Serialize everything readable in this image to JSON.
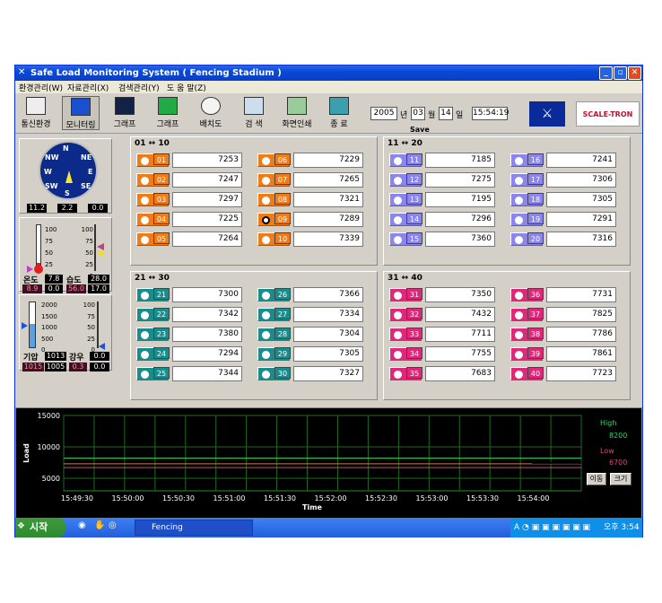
{
  "window": {
    "title": "Safe Load Monitoring System ( Fencing Stadium )"
  },
  "menu": [
    "환경관리(W)",
    "자료관리(X)",
    "검색관리(Y)",
    "도 움 말(Z)"
  ],
  "toolbar": [
    "통신환경",
    "모니터링",
    "그래프",
    "그래프",
    "배치도",
    "검 색",
    "화면인쇄",
    "종 료"
  ],
  "date": {
    "year": "2005",
    "year_unit": "년",
    "month": "03",
    "month_unit": "월",
    "day": "14",
    "day_unit": "일",
    "time": "15:54:19",
    "save": "Save"
  },
  "brand": "SCALE-TRON",
  "compass": {
    "n": "N",
    "ne": "NE",
    "e": "E",
    "se": "SE",
    "s": "S",
    "sw": "SW",
    "w": "W",
    "nw": "NW",
    "r1": "11.2",
    "r2": "2.2",
    "r3": "0.0"
  },
  "thermo": {
    "ticks": [
      "100",
      "75",
      "50",
      "25",
      "0"
    ],
    "label_temp": "온도",
    "temp": "7.8",
    "label_hum": "습도",
    "hum": "28.0",
    "t2": "8.9",
    "t3": "0.0",
    "h2": "56.0",
    "h3": "17.0"
  },
  "pressure": {
    "ticks": [
      "2000",
      "1500",
      "1000",
      "500",
      "0"
    ],
    "rticks": [
      "100",
      "75",
      "50",
      "25",
      "0"
    ],
    "label_press": "기압",
    "press": "1013",
    "label_rain": "강우",
    "rain": "0.0",
    "p2": "1015",
    "p3": "1005",
    "r2": "0.3",
    "r3": "0.0"
  },
  "groups": {
    "g1": {
      "title": "01 ↔ 10",
      "color": "#f07c18",
      "ch": [
        [
          "01",
          "7253"
        ],
        [
          "02",
          "7247"
        ],
        [
          "03",
          "7297"
        ],
        [
          "04",
          "7225"
        ],
        [
          "05",
          "7264"
        ],
        [
          "06",
          "7229"
        ],
        [
          "07",
          "7265"
        ],
        [
          "08",
          "7321"
        ],
        [
          "09",
          "7289"
        ],
        [
          "10",
          "7339"
        ]
      ]
    },
    "g2": {
      "title": "11 ↔ 20",
      "color": "#8a86ee",
      "ch": [
        [
          "11",
          "7185"
        ],
        [
          "12",
          "7275"
        ],
        [
          "13",
          "7195"
        ],
        [
          "14",
          "7296"
        ],
        [
          "15",
          "7360"
        ],
        [
          "16",
          "7241"
        ],
        [
          "17",
          "7306"
        ],
        [
          "18",
          "7305"
        ],
        [
          "19",
          "7291"
        ],
        [
          "20",
          "7316"
        ]
      ]
    },
    "g3": {
      "title": "21 ↔ 30",
      "color": "#1b8c8c",
      "ch": [
        [
          "21",
          "7300"
        ],
        [
          "22",
          "7342"
        ],
        [
          "23",
          "7380"
        ],
        [
          "24",
          "7294"
        ],
        [
          "25",
          "7344"
        ],
        [
          "26",
          "7366"
        ],
        [
          "27",
          "7334"
        ],
        [
          "28",
          "7304"
        ],
        [
          "29",
          "7305"
        ],
        [
          "30",
          "7327"
        ]
      ]
    },
    "g4": {
      "title": "31 ↔ 40",
      "color": "#e0287a",
      "ch": [
        [
          "31",
          "7350"
        ],
        [
          "32",
          "7432"
        ],
        [
          "33",
          "7711"
        ],
        [
          "34",
          "7755"
        ],
        [
          "35",
          "7683"
        ],
        [
          "36",
          "7731"
        ],
        [
          "37",
          "7825"
        ],
        [
          "38",
          "7786"
        ],
        [
          "39",
          "7861"
        ],
        [
          "40",
          "7723"
        ]
      ]
    }
  },
  "chart_data": {
    "type": "line",
    "ylabel": "Load",
    "xlabel": "Time",
    "yticks": [
      "15000",
      "10000",
      "5000"
    ],
    "ylim": [
      3000,
      15000
    ],
    "x": [
      "15:49:30",
      "15:50:00",
      "15:50:30",
      "15:51:00",
      "15:51:30",
      "15:52:00",
      "15:52:30",
      "15:53:00",
      "15:53:30",
      "15:54:00"
    ],
    "series": [
      {
        "name": "High",
        "value": 8200,
        "color": "#2fd66a",
        "label": "8200"
      },
      {
        "name": "Low",
        "value": 6700,
        "color": "#d8467a",
        "label": "6700"
      }
    ],
    "load_level": 7300,
    "high_title": "High",
    "low_title": "Low",
    "btn1": "이동",
    "btn2": "크기"
  },
  "taskbar": {
    "start": "시작",
    "item": "Fencing",
    "clock": "오후 3:54"
  }
}
